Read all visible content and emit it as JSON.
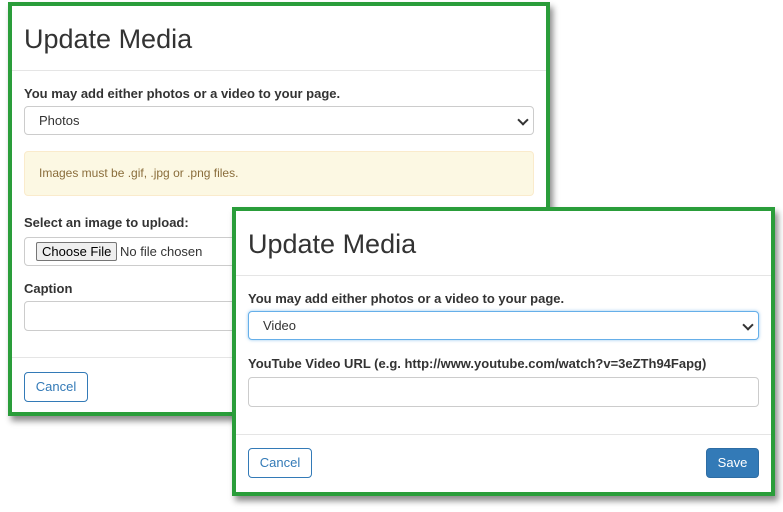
{
  "photos_modal": {
    "title": "Update Media",
    "prompt": "You may add either photos or a video to your page.",
    "media_type_value": "Photos",
    "alert_text": "Images must be .gif, .jpg or .png files.",
    "upload_label": "Select an image to upload:",
    "choose_file_label": "Choose File",
    "file_status": "No file chosen",
    "caption_label": "Caption",
    "cancel_label": "Cancel"
  },
  "video_modal": {
    "title": "Update Media",
    "prompt": "You may add either photos or a video to your page.",
    "media_type_value": "Video",
    "url_label": "YouTube Video URL (e.g. http://www.youtube.com/watch?v=3eZTh94Fapg)",
    "url_value": "",
    "cancel_label": "Cancel",
    "save_label": "Save"
  },
  "colors": {
    "frame_border": "#2a9d3a",
    "primary": "#337ab7",
    "alert_bg": "#fcf8e3",
    "alert_text": "#8a6d3b"
  },
  "icons": [
    "chevron-down-icon"
  ]
}
